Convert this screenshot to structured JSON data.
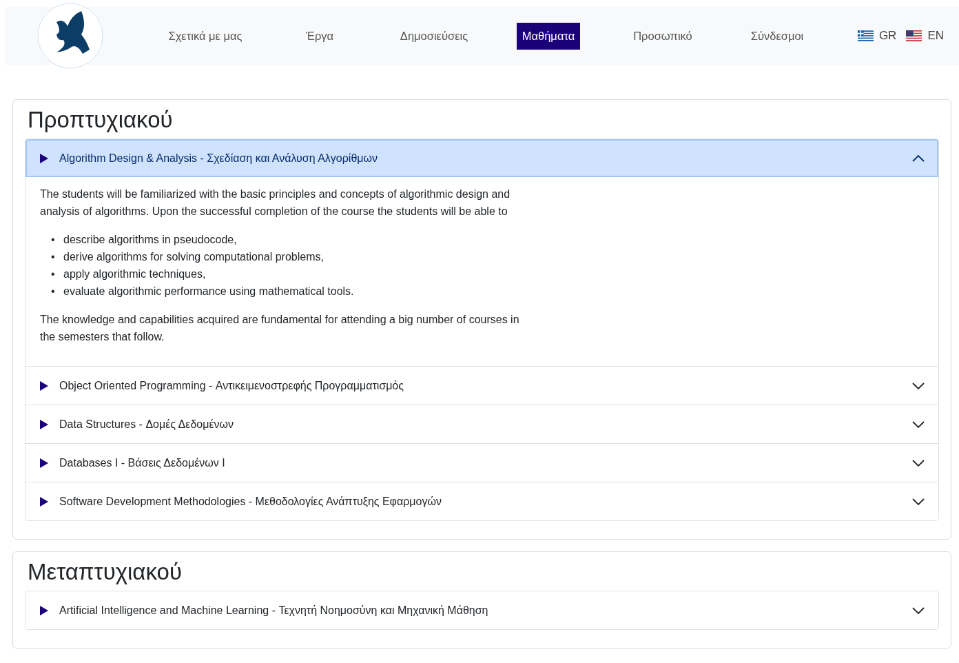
{
  "nav": {
    "items": [
      {
        "label": "Σχετικά με μας",
        "selected": false
      },
      {
        "label": "Έργα",
        "selected": false
      },
      {
        "label": "Δημοσιεύσεις",
        "selected": false
      },
      {
        "label": "Μαθήματα",
        "selected": true
      },
      {
        "label": "Προσωπικό",
        "selected": false
      },
      {
        "label": "Σύνδεσμοι",
        "selected": false
      }
    ],
    "languages": [
      {
        "kind": "greek",
        "label": "GR"
      },
      {
        "kind": "us",
        "label": "EN"
      }
    ]
  },
  "sections": [
    {
      "title": "Προπτυχιακού",
      "courses": [
        {
          "title": "Algorithm Design & Analysis - Σχεδίαση και Ανάλυση Αλγορίθμων",
          "expanded": true,
          "body": {
            "intro": "The students will be familiarized with the basic principles and concepts of algorithmic design and analysis of algorithms. Upon the successful completion of the course the students will be able to",
            "bullets": [
              {
                "marker": "•",
                "text": "describe algorithms in pseudocode,"
              },
              {
                "marker": "•",
                "text": "derive algorithms for solving computational problems,"
              },
              {
                "marker": "•",
                "text": "apply algorithmic techniques,"
              },
              {
                "marker": "•",
                "text": "evaluate algorithmic performance using mathematical tools."
              }
            ],
            "outro": "The knowledge and capabilities acquired are fundamental for attending a big number of courses in the semesters that follow."
          }
        },
        {
          "title": "Object Oriented Programming - Αντικειμενοστρεφής Προγραμματισμός",
          "expanded": false
        },
        {
          "title": "Data Structures - Δομές Δεδομένων",
          "expanded": false
        },
        {
          "title": "Databases I - Βάσεις Δεδομένων I",
          "expanded": false
        },
        {
          "title": "Software Development Methodologies - Μεθοδολογίες Ανάπτυξης Εφαρμογών",
          "expanded": false
        }
      ]
    },
    {
      "title": "Μεταπτυχιακού",
      "courses": [
        {
          "title": "Artificial Intelligence and Machine Learning - Τεχνητή Νοημοσύνη και Μηχανική Μάθηση",
          "expanded": false
        }
      ]
    }
  ]
}
